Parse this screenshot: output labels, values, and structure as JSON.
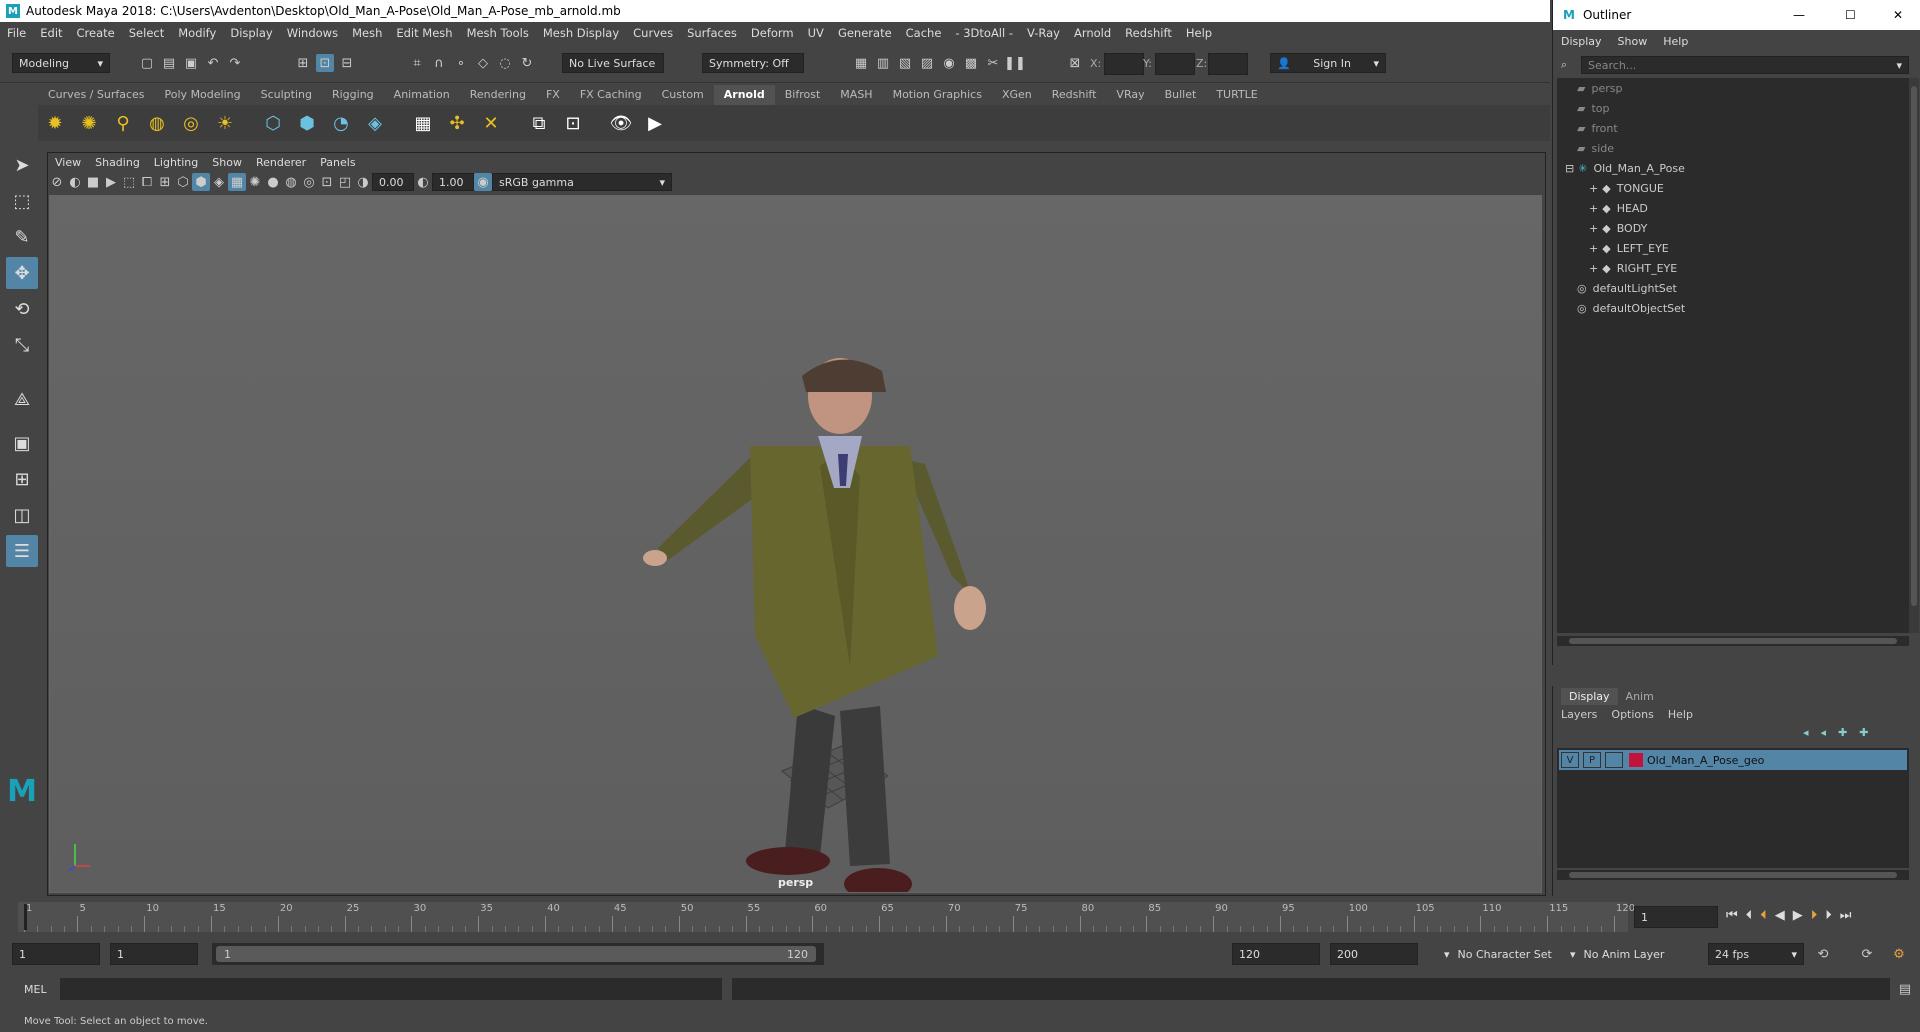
{
  "window": {
    "title": "Autodesk Maya 2018: C:\\Users\\Avdenton\\Desktop\\Old_Man_A-Pose\\Old_Man_A-Pose_mb_arnold.mb"
  },
  "menubar": [
    "File",
    "Edit",
    "Create",
    "Select",
    "Modify",
    "Display",
    "Windows",
    "Mesh",
    "Edit Mesh",
    "Mesh Tools",
    "Mesh Display",
    "Curves",
    "Surfaces",
    "Deform",
    "UV",
    "Generate",
    "Cache",
    "- 3DtoAll -",
    "V-Ray",
    "Arnold",
    "Redshift",
    "Help"
  ],
  "statusline": {
    "mode": "Modeling",
    "live_surface": "No Live Surface",
    "symmetry": "Symmetry: Off",
    "x_label": "X:",
    "y_label": "Y:",
    "z_label": "Z:",
    "sign_in": "Sign In"
  },
  "shelf_tabs": [
    "Curves / Surfaces",
    "Poly Modeling",
    "Sculpting",
    "Rigging",
    "Animation",
    "Rendering",
    "FX",
    "FX Caching",
    "Custom",
    "Arnold",
    "Bifrost",
    "MASH",
    "Motion Graphics",
    "XGen",
    "Redshift",
    "VRay",
    "Bullet",
    "TURTLE"
  ],
  "shelf_active": "Arnold",
  "viewport": {
    "menu": [
      "View",
      "Shading",
      "Lighting",
      "Show",
      "Renderer",
      "Panels"
    ],
    "exposure": "0.00",
    "gamma": "1.00",
    "color_space": "sRGB gamma",
    "camera_label": "persp"
  },
  "outliner": {
    "title": "Outliner",
    "menu": [
      "Display",
      "Show",
      "Help"
    ],
    "search_placeholder": "Search...",
    "items": [
      {
        "label": "persp",
        "type": "camera",
        "indent": 1
      },
      {
        "label": "top",
        "type": "camera",
        "indent": 1
      },
      {
        "label": "front",
        "type": "camera",
        "indent": 1
      },
      {
        "label": "side",
        "type": "camera",
        "indent": 1
      },
      {
        "label": "Old_Man_A_Pose",
        "type": "group",
        "indent": 0
      },
      {
        "label": "TONGUE",
        "type": "mesh",
        "indent": 2
      },
      {
        "label": "HEAD",
        "type": "mesh",
        "indent": 2
      },
      {
        "label": "BODY",
        "type": "mesh",
        "indent": 2
      },
      {
        "label": "LEFT_EYE",
        "type": "mesh",
        "indent": 2
      },
      {
        "label": "RIGHT_EYE",
        "type": "mesh",
        "indent": 2
      },
      {
        "label": "defaultLightSet",
        "type": "set",
        "indent": 1
      },
      {
        "label": "defaultObjectSet",
        "type": "set",
        "indent": 1
      }
    ]
  },
  "layer_editor": {
    "tabs": [
      "Display",
      "Anim"
    ],
    "menu": [
      "Layers",
      "Options",
      "Help"
    ],
    "layer": {
      "v": "V",
      "p": "P",
      "name": "Old_Man_A_Pose_geo",
      "color": "#c0143c"
    }
  },
  "timeline": {
    "ticks": [
      "1",
      "5",
      "10",
      "15",
      "20",
      "25",
      "30",
      "35",
      "40",
      "45",
      "50",
      "55",
      "60",
      "65",
      "70",
      "75",
      "80",
      "85",
      "90",
      "95",
      "100",
      "105",
      "110",
      "115",
      "120"
    ],
    "current_frame": "1"
  },
  "range": {
    "start": "1",
    "playback_start": "1",
    "slider_start": "1",
    "slider_end": "120",
    "playback_end": "120",
    "end": "200",
    "character_set": "No Character Set",
    "anim_layer": "No Anim Layer",
    "fps": "24 fps"
  },
  "cmdline": {
    "label": "MEL"
  },
  "helpline": {
    "text": "Move Tool: Select an object to move."
  },
  "colors": {
    "accent": "#5285a6",
    "bg": "#444444",
    "field": "#2b2b2b",
    "layer_selected": "#5285a6"
  }
}
